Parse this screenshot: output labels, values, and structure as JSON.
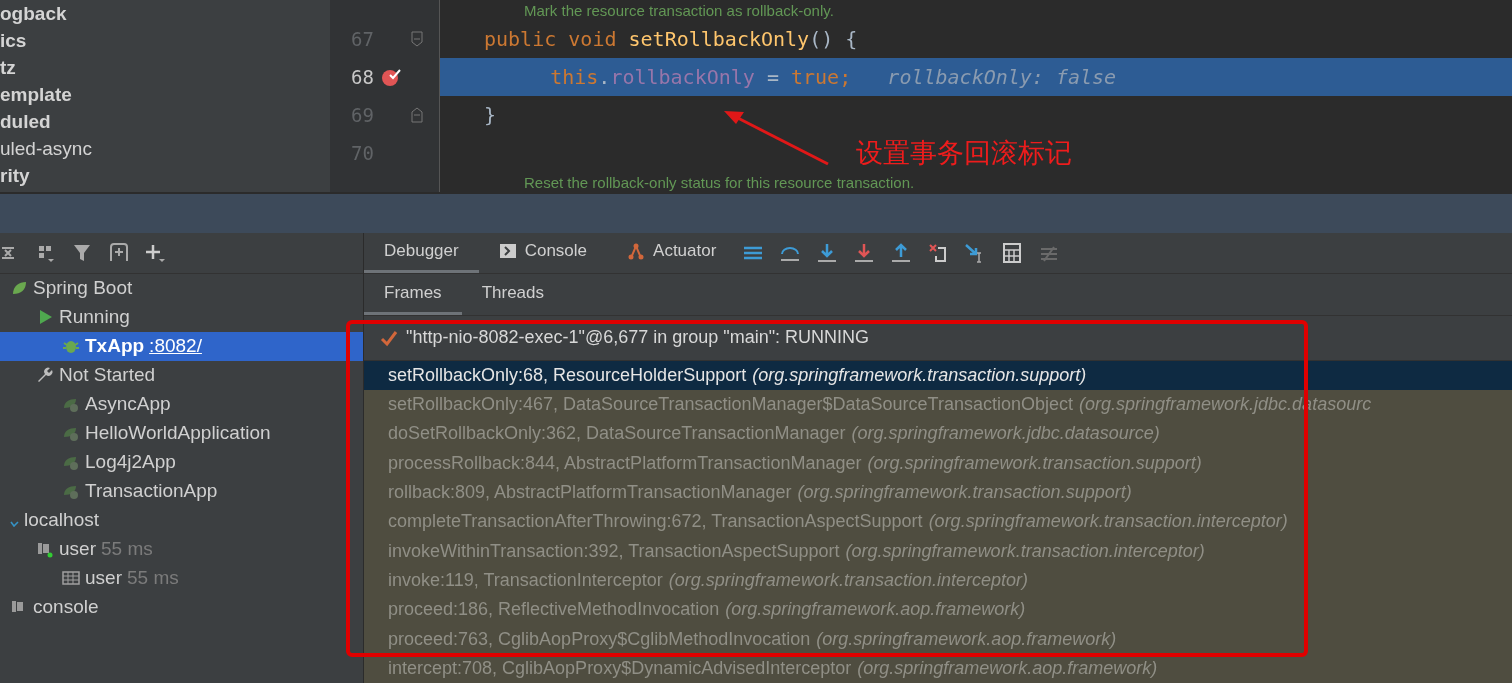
{
  "project_tree": [
    {
      "label": "ogback",
      "bold": true
    },
    {
      "label": "ics",
      "bold": true
    },
    {
      "label": "tz",
      "bold": true
    },
    {
      "label": "emplate",
      "bold": true
    },
    {
      "label": "duled",
      "bold": true
    },
    {
      "label": "uled-async",
      "bold": false
    },
    {
      "label": "rity",
      "bold": true
    }
  ],
  "editor": {
    "lines": [
      {
        "kind": "doc",
        "tokens": [
          {
            "text": "Mark the resource transaction as rollback-only.",
            "kind": "doc"
          }
        ]
      },
      {
        "kind": "code",
        "number": "67",
        "fold": true,
        "current": false,
        "breakpoint": false,
        "tokens": [
          {
            "text": "public ",
            "kind": "keyword"
          },
          {
            "text": "void ",
            "kind": "keyword"
          },
          {
            "text": "setRollbackOnly",
            "kind": "method"
          },
          {
            "text": "() {",
            "kind": "plain"
          }
        ]
      },
      {
        "kind": "code",
        "number": "68",
        "current": true,
        "breakpoint": true,
        "tokens": [
          {
            "text": "    this",
            "kind": "keyword"
          },
          {
            "text": ".",
            "kind": "plain"
          },
          {
            "text": "rollbackOnly",
            "kind": "field"
          },
          {
            "text": " = ",
            "kind": "plain"
          },
          {
            "text": "true",
            "kind": "keyword"
          },
          {
            "text": ";",
            "kind": "keyword"
          },
          {
            "text": "   rollbackOnly: false",
            "kind": "inline"
          }
        ]
      },
      {
        "kind": "code",
        "number": "69",
        "fold": true,
        "current": false,
        "breakpoint": false,
        "tokens": [
          {
            "text": "}",
            "kind": "plain"
          }
        ]
      },
      {
        "kind": "code",
        "number": "70",
        "current": false,
        "breakpoint": false
      },
      {
        "kind": "doc",
        "tokens": [
          {
            "text": "Reset the rollback-only status for this resource transaction.",
            "kind": "doc"
          }
        ]
      }
    ],
    "annotation": "设置事务回滚标记"
  },
  "services": {
    "items": [
      {
        "label": "Spring Boot",
        "kind": "spring",
        "expanded": true,
        "children": [
          {
            "label": "Running",
            "kind": "running",
            "expanded": true,
            "children": [
              {
                "label": "TxApp",
                "link": ":8082/",
                "kind": "debugging",
                "selected": true
              }
            ]
          },
          {
            "label": "Not Started",
            "kind": "stopped",
            "expanded": true,
            "children": [
              {
                "label": "AsyncApp",
                "kind": "app",
                "selected": false
              },
              {
                "label": "HelloWorldApplication",
                "kind": "app",
                "selected": false
              },
              {
                "label": "Log4j2App",
                "kind": "app",
                "selected": false
              },
              {
                "label": "TransactionApp",
                "kind": "app",
                "selected": false
              }
            ]
          }
        ]
      },
      {
        "label": "localhost",
        "kind": "database",
        "expanded": true,
        "children": [
          {
            "label": "user",
            "detail": "55 ms",
            "kind": "session",
            "expanded": true,
            "children": [
              {
                "label": "user",
                "detail": "55 ms",
                "kind": "table",
                "selected": false
              }
            ]
          }
        ]
      },
      {
        "label": "console",
        "kind": "console",
        "selected": false
      }
    ]
  },
  "debug_tabs": [
    {
      "label": "Debugger",
      "kind": "plain",
      "selected": true
    },
    {
      "label": "Console",
      "kind": "console",
      "selected": false
    },
    {
      "label": "Actuator",
      "kind": "actuator",
      "selected": false
    }
  ],
  "sub_tabs": [
    {
      "label": "Frames",
      "selected": true
    },
    {
      "label": "Threads",
      "selected": false
    }
  ],
  "thread": "\"http-nio-8082-exec-1\"@6,677 in group \"main\": RUNNING",
  "frames": [
    {
      "method": "setRollbackOnly:68, ResourceHolderSupport",
      "package": "(org.springframework.transaction.support)",
      "selected": true
    },
    {
      "method": "setRollbackOnly:467, DataSourceTransactionManager$DataSourceTransactionObject",
      "package": "(org.springframework.jdbc.datasourc",
      "selected": false
    },
    {
      "method": "doSetRollbackOnly:362, DataSourceTransactionManager",
      "package": "(org.springframework.jdbc.datasource)",
      "selected": false
    },
    {
      "method": "processRollback:844, AbstractPlatformTransactionManager",
      "package": "(org.springframework.transaction.support)",
      "selected": false
    },
    {
      "method": "rollback:809, AbstractPlatformTransactionManager",
      "package": "(org.springframework.transaction.support)",
      "selected": false
    },
    {
      "method": "completeTransactionAfterThrowing:672, TransactionAspectSupport",
      "package": "(org.springframework.transaction.interceptor)",
      "selected": false
    },
    {
      "method": "invokeWithinTransaction:392, TransactionAspectSupport",
      "package": "(org.springframework.transaction.interceptor)",
      "selected": false
    },
    {
      "method": "invoke:119, TransactionInterceptor",
      "package": "(org.springframework.transaction.interceptor)",
      "selected": false
    },
    {
      "method": "proceed:186, ReflectiveMethodInvocation",
      "package": "(org.springframework.aop.framework)",
      "selected": false
    },
    {
      "method": "proceed:763, CglibAopProxy$CglibMethodInvocation",
      "package": "(org.springframework.aop.framework)",
      "selected": false
    },
    {
      "method": "intercept:708, CglibAopProxy$DynamicAdvisedInterceptor",
      "package": "(org.springframework.aop.framework)",
      "selected": false
    }
  ]
}
